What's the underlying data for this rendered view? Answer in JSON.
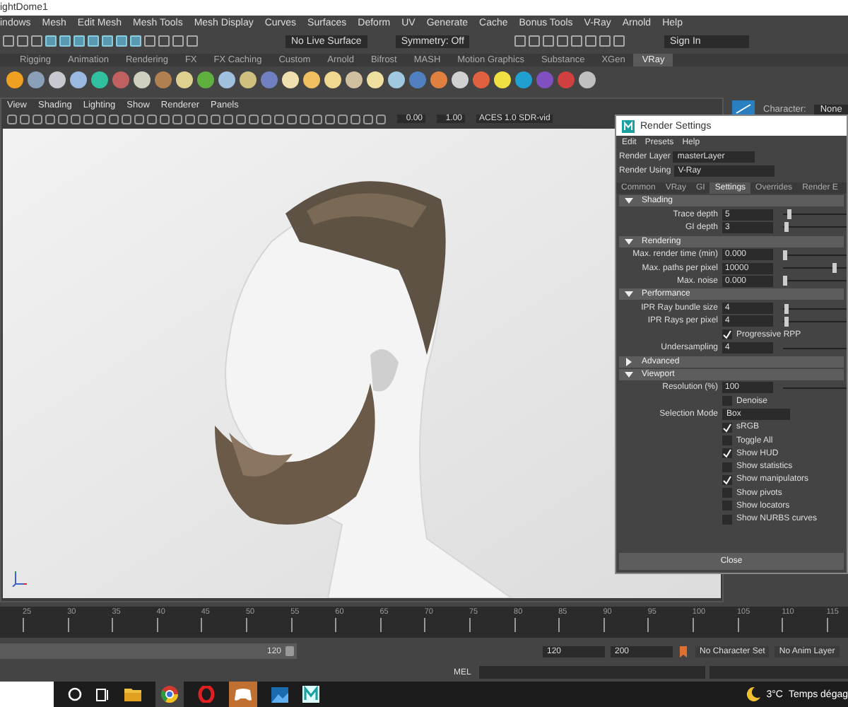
{
  "window": {
    "title": "ightDome1"
  },
  "menu_bar": [
    "indows",
    "Mesh",
    "Edit Mesh",
    "Mesh Tools",
    "Mesh Display",
    "Curves",
    "Surfaces",
    "Deform",
    "UV",
    "Generate",
    "Cache",
    "Bonus Tools",
    "V-Ray",
    "Arnold",
    "Help"
  ],
  "status_line": {
    "live_surface": "No Live Surface",
    "symmetry": "Symmetry: Off",
    "sign_in": "Sign In"
  },
  "shelf_tabs": [
    {
      "label": "Rigging",
      "selected": false
    },
    {
      "label": "Animation",
      "selected": false
    },
    {
      "label": "Rendering",
      "selected": false
    },
    {
      "label": "FX",
      "selected": false
    },
    {
      "label": "FX Caching",
      "selected": false
    },
    {
      "label": "Custom",
      "selected": false
    },
    {
      "label": "Arnold",
      "selected": false
    },
    {
      "label": "Bifrost",
      "selected": false
    },
    {
      "label": "MASH",
      "selected": false
    },
    {
      "label": "Motion Graphics",
      "selected": false
    },
    {
      "label": "Substance",
      "selected": false
    },
    {
      "label": "XGen",
      "selected": false
    },
    {
      "label": "VRay",
      "selected": true
    }
  ],
  "viewport": {
    "menus": [
      "View",
      "Shading",
      "Lighting",
      "Show",
      "Renderer",
      "Panels"
    ],
    "fields": [
      "0.00",
      "1.00"
    ],
    "color_space": "ACES 1.0 SDR-vid"
  },
  "channel_box": {
    "character_label": "Character:",
    "character_value": "None"
  },
  "render_settings": {
    "title": "Render Settings",
    "menus": [
      "Edit",
      "Presets",
      "Help"
    ],
    "render_layer_label": "Render Layer",
    "render_layer": "masterLayer",
    "render_using_label": "Render Using",
    "render_using": "V-Ray",
    "tabs": [
      {
        "label": "Common",
        "selected": false
      },
      {
        "label": "VRay",
        "selected": false
      },
      {
        "label": "GI",
        "selected": false
      },
      {
        "label": "Settings",
        "selected": true
      },
      {
        "label": "Overrides",
        "selected": false
      },
      {
        "label": "Render E",
        "selected": false
      }
    ],
    "sections": [
      {
        "title": "Shading",
        "expanded": true,
        "rows": [
          {
            "kind": "slider",
            "label": "Trace depth",
            "value": "5",
            "level": 0.06
          },
          {
            "kind": "slider",
            "label": "GI depth",
            "value": "3",
            "level": 0.03
          }
        ]
      },
      {
        "title": "Rendering",
        "expanded": true,
        "rows": [
          {
            "kind": "slider",
            "label": "Max. render time (min)",
            "value": "0.000",
            "level": 0
          },
          {
            "kind": "slider",
            "label": "Max. paths per pixel",
            "value": "10000",
            "level": 0.78
          },
          {
            "kind": "slider",
            "label": "Max. noise",
            "value": "0.000",
            "level": 0
          }
        ]
      },
      {
        "title": "Performance",
        "expanded": true,
        "rows": [
          {
            "kind": "slider",
            "label": "IPR Ray bundle size",
            "value": "4",
            "level": 0.03
          },
          {
            "kind": "slider",
            "label": "IPR Rays per pixel",
            "value": "4",
            "level": 0.03
          },
          {
            "kind": "checkbox",
            "label": "Progressive RPP",
            "checked": true
          },
          {
            "kind": "slider",
            "label": "Undersampling",
            "value": "4"
          }
        ]
      },
      {
        "title": "Advanced",
        "expanded": false
      },
      {
        "title": "Viewport",
        "expanded": true,
        "rows": [
          {
            "kind": "slider",
            "label": "Resolution (%)",
            "value": "100"
          },
          {
            "kind": "checkbox",
            "label": "Denoise",
            "checked": false
          },
          {
            "kind": "dropdown",
            "label": "Selection Mode",
            "value": "Box"
          },
          {
            "kind": "checkbox",
            "label": "sRGB",
            "checked": true
          },
          {
            "kind": "checkbox",
            "label": "Toggle All",
            "checked": false
          },
          {
            "kind": "checkbox",
            "label": "Show HUD",
            "checked": true
          },
          {
            "kind": "checkbox",
            "label": "Show statistics",
            "checked": false
          },
          {
            "kind": "checkbox",
            "label": "Show manipulators",
            "checked": true
          },
          {
            "kind": "checkbox",
            "label": "Show pivots",
            "checked": false
          },
          {
            "kind": "checkbox",
            "label": "Show locators",
            "checked": false
          },
          {
            "kind": "checkbox",
            "label": "Show NURBS curves",
            "checked": false
          }
        ]
      }
    ],
    "close": "Close"
  },
  "timeline": {
    "ticks": [
      "25",
      "30",
      "35",
      "40",
      "45",
      "50",
      "55",
      "60",
      "65",
      "70",
      "75",
      "80",
      "85",
      "90",
      "95",
      "100",
      "105",
      "110",
      "115"
    ]
  },
  "range": {
    "current": "120",
    "start": "120",
    "end": "200",
    "character_set": "No Character Set",
    "anim_layer": "No Anim Layer"
  },
  "command_line": {
    "language": "MEL"
  },
  "taskbar": {
    "temperature": "3°C",
    "weather": "Temps dégag"
  }
}
